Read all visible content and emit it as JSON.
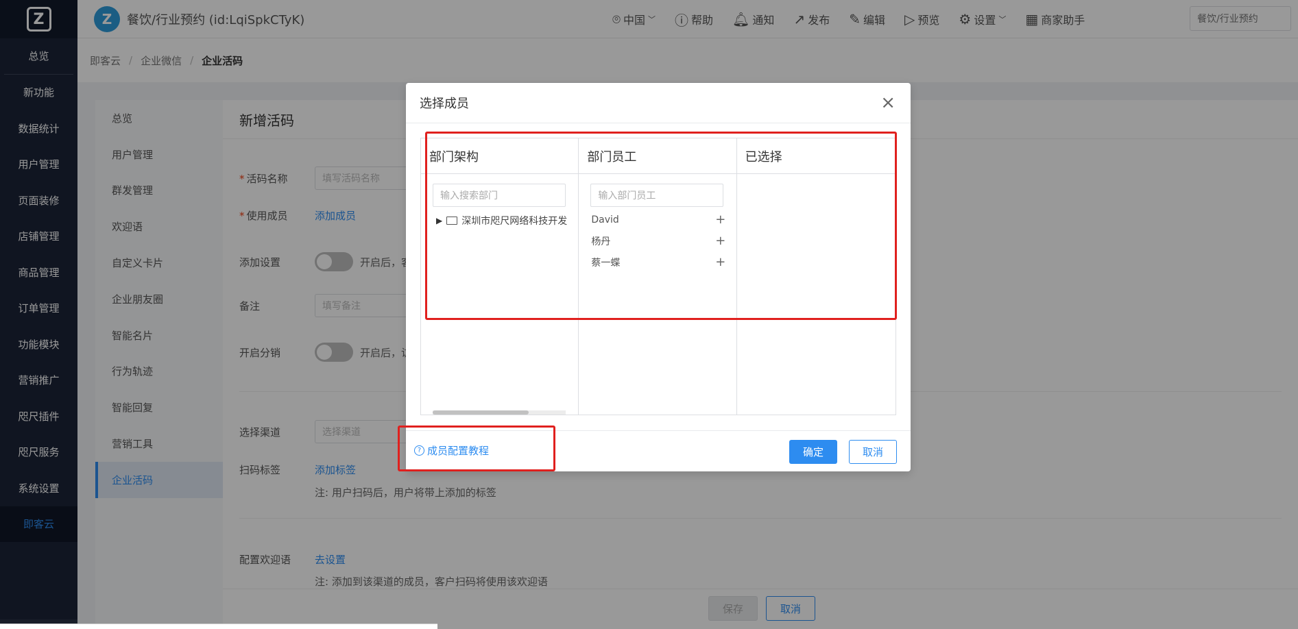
{
  "sidebar": {
    "items": [
      "总览",
      "新功能",
      "数据统计",
      "用户管理",
      "页面装修",
      "店铺管理",
      "商品管理",
      "订单管理",
      "功能模块",
      "营销推广",
      "咫尺插件",
      "咫尺服务",
      "系统设置",
      "即客云"
    ]
  },
  "header": {
    "app_title": "餐饮/行业预约 (id:LqiSpkCTyK)",
    "nav": [
      {
        "icon": "location-icon",
        "label": "中国"
      },
      {
        "icon": "help-icon",
        "label": "帮助"
      },
      {
        "icon": "bell-icon",
        "label": "通知"
      },
      {
        "icon": "publish-icon",
        "label": "发布"
      },
      {
        "icon": "edit-icon",
        "label": "编辑"
      },
      {
        "icon": "preview-icon",
        "label": "预览"
      },
      {
        "icon": "gear-icon",
        "label": "设置"
      },
      {
        "icon": "qrcode-icon",
        "label": "商家助手"
      }
    ],
    "select_value": "餐饮/行业预约"
  },
  "breadcrumb": [
    "即客云",
    "企业微信",
    "企业活码"
  ],
  "submenu": {
    "items": [
      "总览",
      "用户管理",
      "群发管理",
      "欢迎语",
      "自定义卡片",
      "企业朋友圈",
      "智能名片",
      "行为轨迹",
      "智能回复",
      "营销工具",
      "企业活码"
    ]
  },
  "form": {
    "title": "新增活码",
    "name_label": "活码名称",
    "name_placeholder": "填写活码名称",
    "member_label": "使用成员",
    "member_link": "添加成员",
    "add_setting_label": "添加设置",
    "add_setting_text": "开启后，客",
    "remark_label": "备注",
    "remark_placeholder": "填写备注",
    "distribution_label": "开启分销",
    "distribution_text": "开启后，访",
    "channel_label": "选择渠道",
    "channel_placeholder": "选择渠道",
    "tag_label": "扫码标签",
    "tag_link": "添加标签",
    "tag_note": "注: 用户扫码后，用户将带上添加的标签",
    "welcome_label": "配置欢迎语",
    "welcome_link": "去设置",
    "welcome_note": "注: 添加到该渠道的成员，客户扫码将使用该欢迎语",
    "save_label": "保存",
    "cancel_label": "取消"
  },
  "modal": {
    "title": "选择成员",
    "close_glyph": "×",
    "col_departments": "部门架构",
    "col_employees": "部门员工",
    "col_selected": "已选择",
    "dept_search_placeholder": "输入搜索部门",
    "emp_search_placeholder": "输入部门员工",
    "dept_node": "深圳市咫尺网络科技开发",
    "employees": [
      "David",
      "杨丹",
      "蔡一蝶"
    ],
    "tutorial_link": "成员配置教程",
    "ok_label": "确定",
    "cancel_label": "取消"
  },
  "colors": {
    "primary": "#2d8cf0",
    "sidebar_bg": "#1c2438",
    "annotation_red": "#e0201e"
  }
}
